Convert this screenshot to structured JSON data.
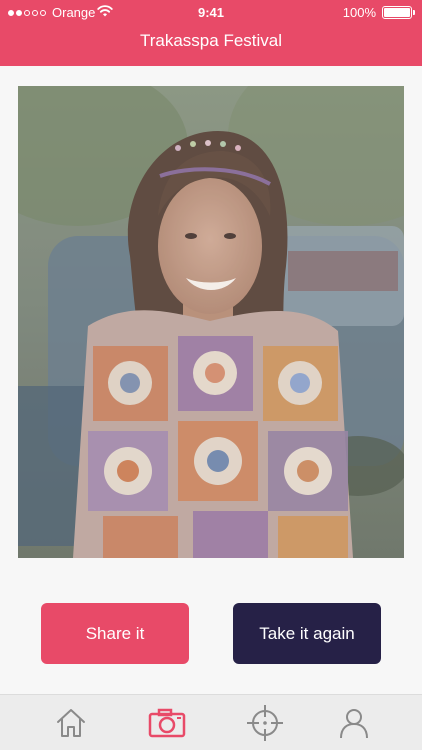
{
  "status_bar": {
    "carrier": "Orange",
    "time": "9:41",
    "battery": "100%",
    "battery_level": 1.0
  },
  "header": {
    "title": "Trakasspa Festival"
  },
  "photo": {
    "subject": "photo-preview"
  },
  "actions": {
    "share_label": "Share it",
    "retake_label": "Take it again"
  },
  "tabbar": {
    "items": [
      {
        "icon": "home-icon",
        "active": false
      },
      {
        "icon": "camera-icon",
        "active": true
      },
      {
        "icon": "crosshair-icon",
        "active": false
      },
      {
        "icon": "profile-icon",
        "active": false
      }
    ]
  },
  "colors": {
    "accent": "#e84a68",
    "dark_button": "#262147",
    "tab_inactive": "#8a8a8a"
  }
}
